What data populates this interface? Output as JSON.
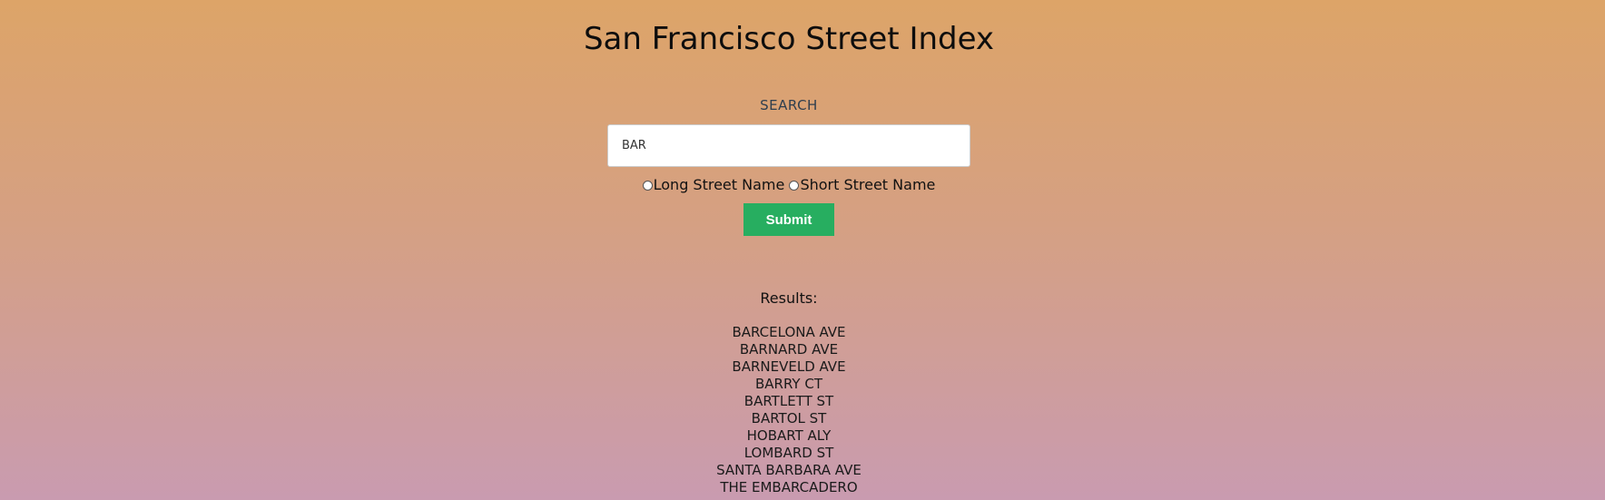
{
  "page": {
    "title": "San Francisco Street Index"
  },
  "search": {
    "label": "SEARCH",
    "value": "BAR",
    "placeholder": ""
  },
  "options": {
    "long": "Long Street Name",
    "short": "Short Street Name",
    "selected": null
  },
  "submit": {
    "label": "Submit"
  },
  "results": {
    "heading": "Results:",
    "items": [
      "BARCELONA AVE",
      "BARNARD AVE",
      "BARNEVELD AVE",
      "BARRY CT",
      "BARTLETT ST",
      "BARTOL ST",
      "HOBART ALY",
      "LOMBARD ST",
      "SANTA BARBARA AVE",
      "THE EMBARCADERO"
    ]
  },
  "colors": {
    "submit_bg": "#27ae60",
    "gradient_top": "#dda468",
    "gradient_bottom": "#c99bb0"
  }
}
